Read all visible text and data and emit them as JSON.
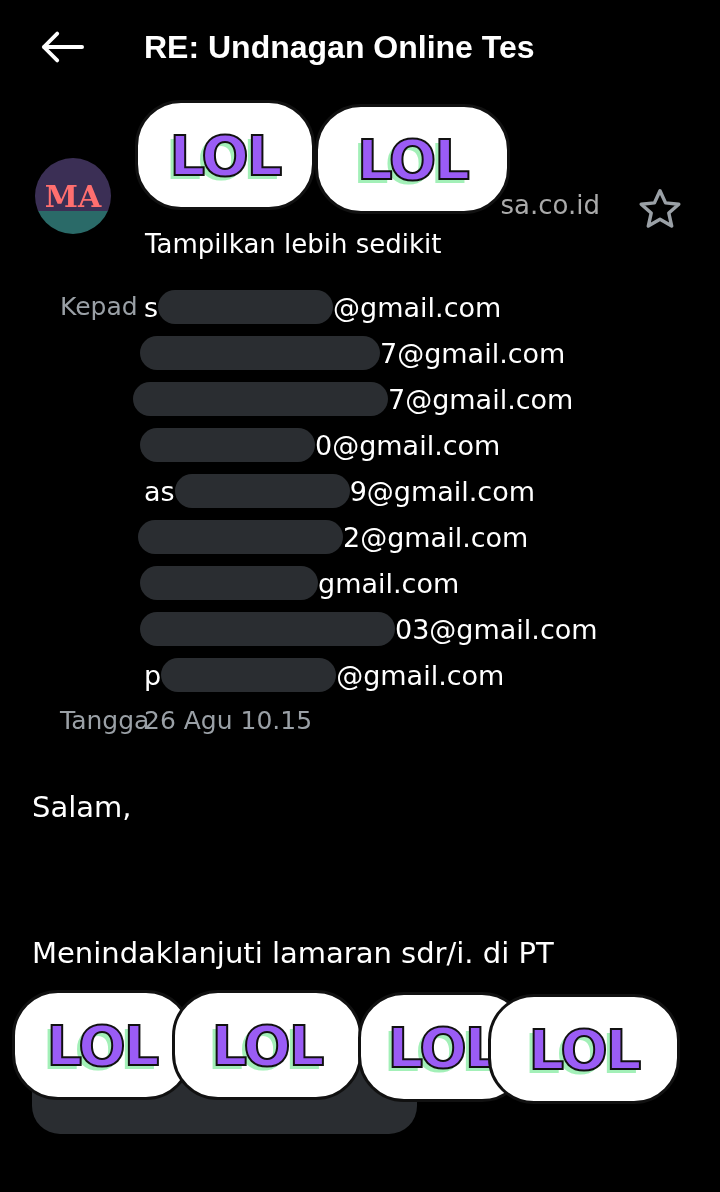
{
  "header": {
    "title": "RE: Undnagan Online Tes"
  },
  "sender": {
    "avatar_text": "MA",
    "address_fragment": "sa.co.id",
    "starred": false,
    "toggle": "Tampilkan lebih sedikit"
  },
  "recipients": {
    "label": "Kepad",
    "items": [
      {
        "prefix": "s",
        "suffix": "@gmail.com"
      },
      {
        "suffix": "7@gmail.com"
      },
      {
        "suffix": "7@gmail.com"
      },
      {
        "suffix": "0@gmail.com"
      },
      {
        "prefix": "as",
        "suffix": "9@gmail.com"
      },
      {
        "suffix": "2@gmail.com"
      },
      {
        "suffix": "gmail.com"
      },
      {
        "suffix": "03@gmail.com"
      },
      {
        "prefix": "p",
        "suffix": "@gmail.com"
      }
    ]
  },
  "date": {
    "label": "Tangga",
    "value": "26 Agu 10.15"
  },
  "body": [
    "Salam,",
    "Menindaklanjuti lamaran sdr/i. di PT"
  ],
  "stickers": [
    "LOL",
    "LOL",
    "LOL",
    "LOL",
    "LOL",
    "LOL"
  ]
}
